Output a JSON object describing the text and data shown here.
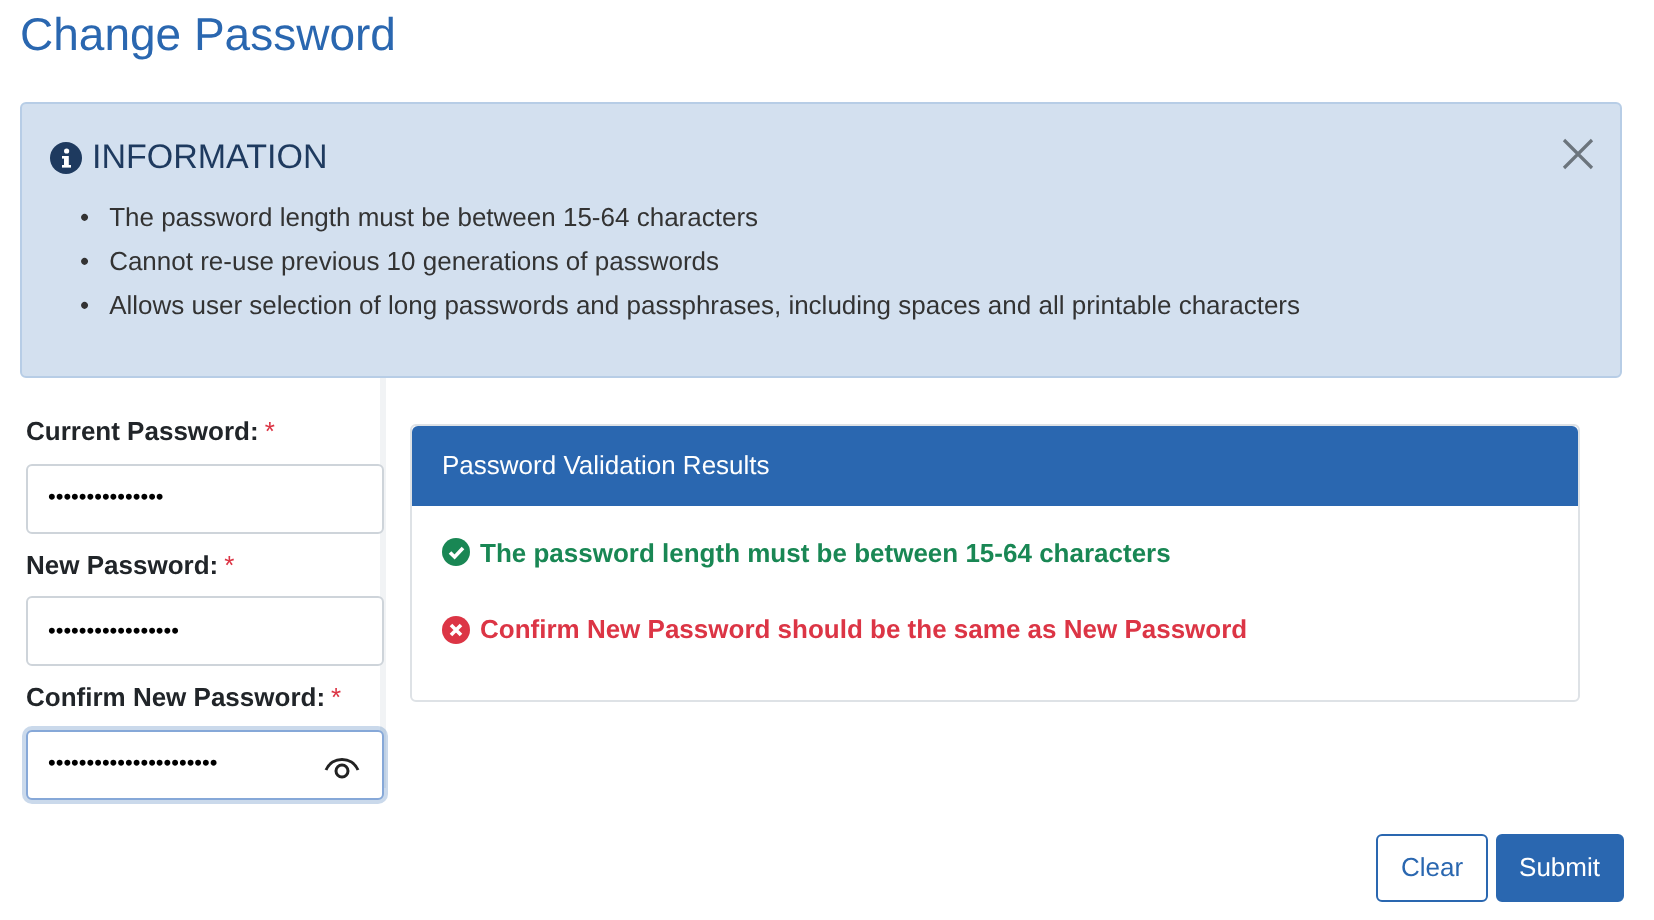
{
  "title": "Change Password",
  "info": {
    "heading": "INFORMATION",
    "items": [
      {
        "bullet": "•",
        "text": "The password length must be between 15-64 characters"
      },
      {
        "bullet": "•",
        "text": "Cannot re-use previous 10 generations of passwords"
      },
      {
        "bullet": "•",
        "text": "Allows user selection of long passwords and passphrases, including spaces and all printable characters"
      }
    ]
  },
  "fields": [
    {
      "label": "Current Password:",
      "required_mark": "*",
      "value": "•••••••••••••••",
      "focused": false,
      "reveal_icon": false
    },
    {
      "label": "New Password:",
      "required_mark": "*",
      "value": "•••••••••••••••••",
      "focused": false,
      "reveal_icon": false
    },
    {
      "label": "Confirm New Password:",
      "required_mark": "*",
      "value": "••••••••••••••••••••••",
      "focused": true,
      "reveal_icon": true
    }
  ],
  "validation": {
    "title": "Password Validation Results",
    "results": [
      {
        "kind": "pass",
        "text": "The password length must be between 15-64 characters"
      },
      {
        "kind": "fail",
        "text": "Confirm New Password should be the same as New Password"
      }
    ]
  },
  "buttons": [
    {
      "kind": "outline",
      "label": "Clear"
    },
    {
      "kind": "primary",
      "label": "Submit"
    }
  ]
}
